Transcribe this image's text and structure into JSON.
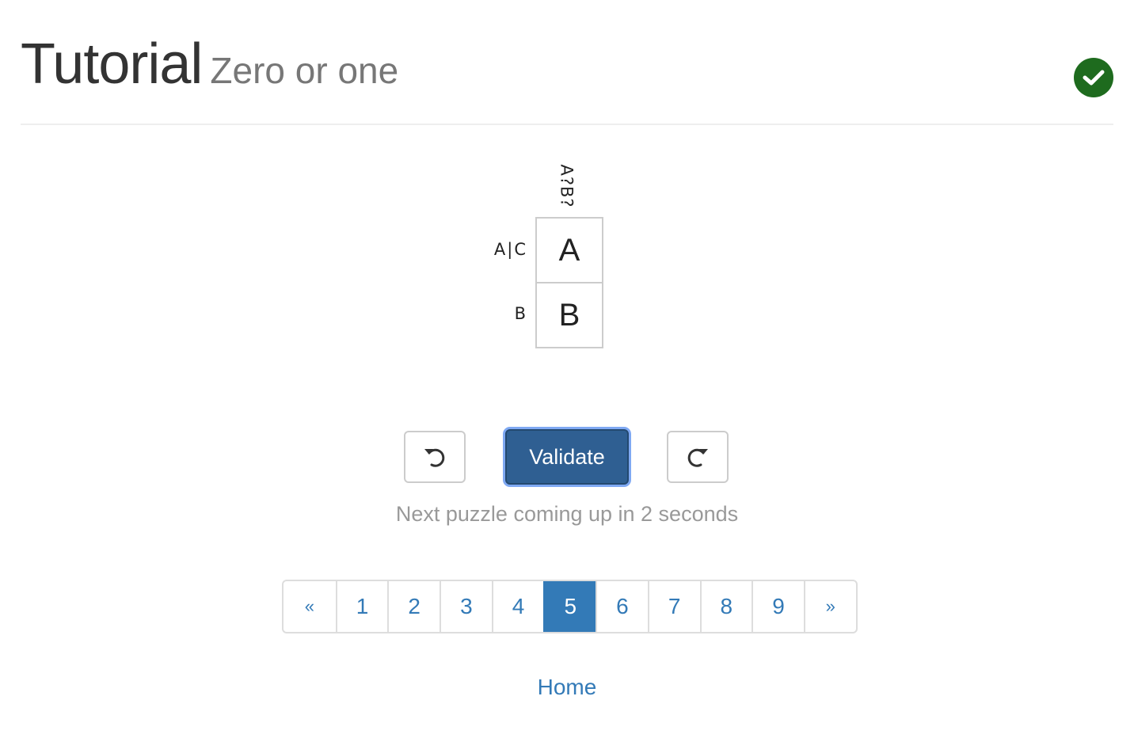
{
  "header": {
    "title": "Tutorial",
    "subtitle": "Zero or one",
    "status_icon": "check-circle-icon",
    "status_color": "#1e6b1e"
  },
  "puzzle": {
    "column_clues": [
      "A?B?"
    ],
    "row_clues": [
      "A|C",
      "B"
    ],
    "cells": [
      "A",
      "B"
    ]
  },
  "controls": {
    "undo_icon": "undo-icon",
    "validate_label": "Validate",
    "redo_icon": "redo-icon",
    "status_text": "Next puzzle coming up in 2 seconds"
  },
  "pagination": {
    "prev_label": "«",
    "pages": [
      "1",
      "2",
      "3",
      "4",
      "5",
      "6",
      "7",
      "8",
      "9"
    ],
    "active_page": "5",
    "next_label": "»"
  },
  "footer": {
    "home_label": "Home"
  },
  "colors": {
    "accent": "#337ab7",
    "validate_bg": "#2f5f92",
    "success": "#1e6b1e"
  }
}
